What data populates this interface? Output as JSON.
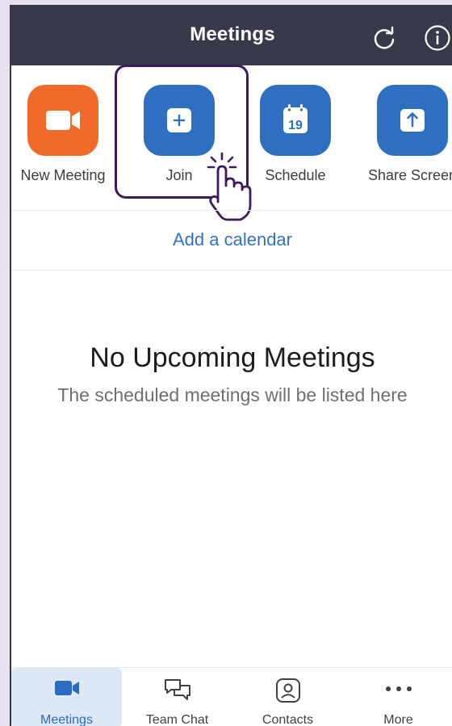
{
  "header": {
    "title": "Meetings"
  },
  "actions": [
    {
      "label": "New Meeting",
      "color": "#f06a2a",
      "icon": "video-camera-icon"
    },
    {
      "label": "Join",
      "color": "#2f6fc0",
      "icon": "plus-icon"
    },
    {
      "label": "Schedule",
      "color": "#2f6fc0",
      "icon": "calendar-icon",
      "calendar_day": "19"
    },
    {
      "label": "Share Screen",
      "color": "#2f6fc0",
      "icon": "upload-arrow-icon"
    }
  ],
  "add_calendar": "Add a calendar",
  "empty_state": {
    "title": "No Upcoming Meetings",
    "subtitle": "The scheduled meetings will be listed here"
  },
  "tabs": [
    {
      "label": "Meetings",
      "icon": "video-camera-icon",
      "active": true
    },
    {
      "label": "Team Chat",
      "icon": "chat-bubbles-icon",
      "active": false
    },
    {
      "label": "Contacts",
      "icon": "contact-card-icon",
      "active": false
    },
    {
      "label": "More",
      "icon": "more-dots-icon",
      "active": false
    }
  ],
  "colors": {
    "header_bg": "#383a4b",
    "accent": "#2f6fc0",
    "orange": "#f06a2a",
    "highlight": "#3d1a5b"
  }
}
